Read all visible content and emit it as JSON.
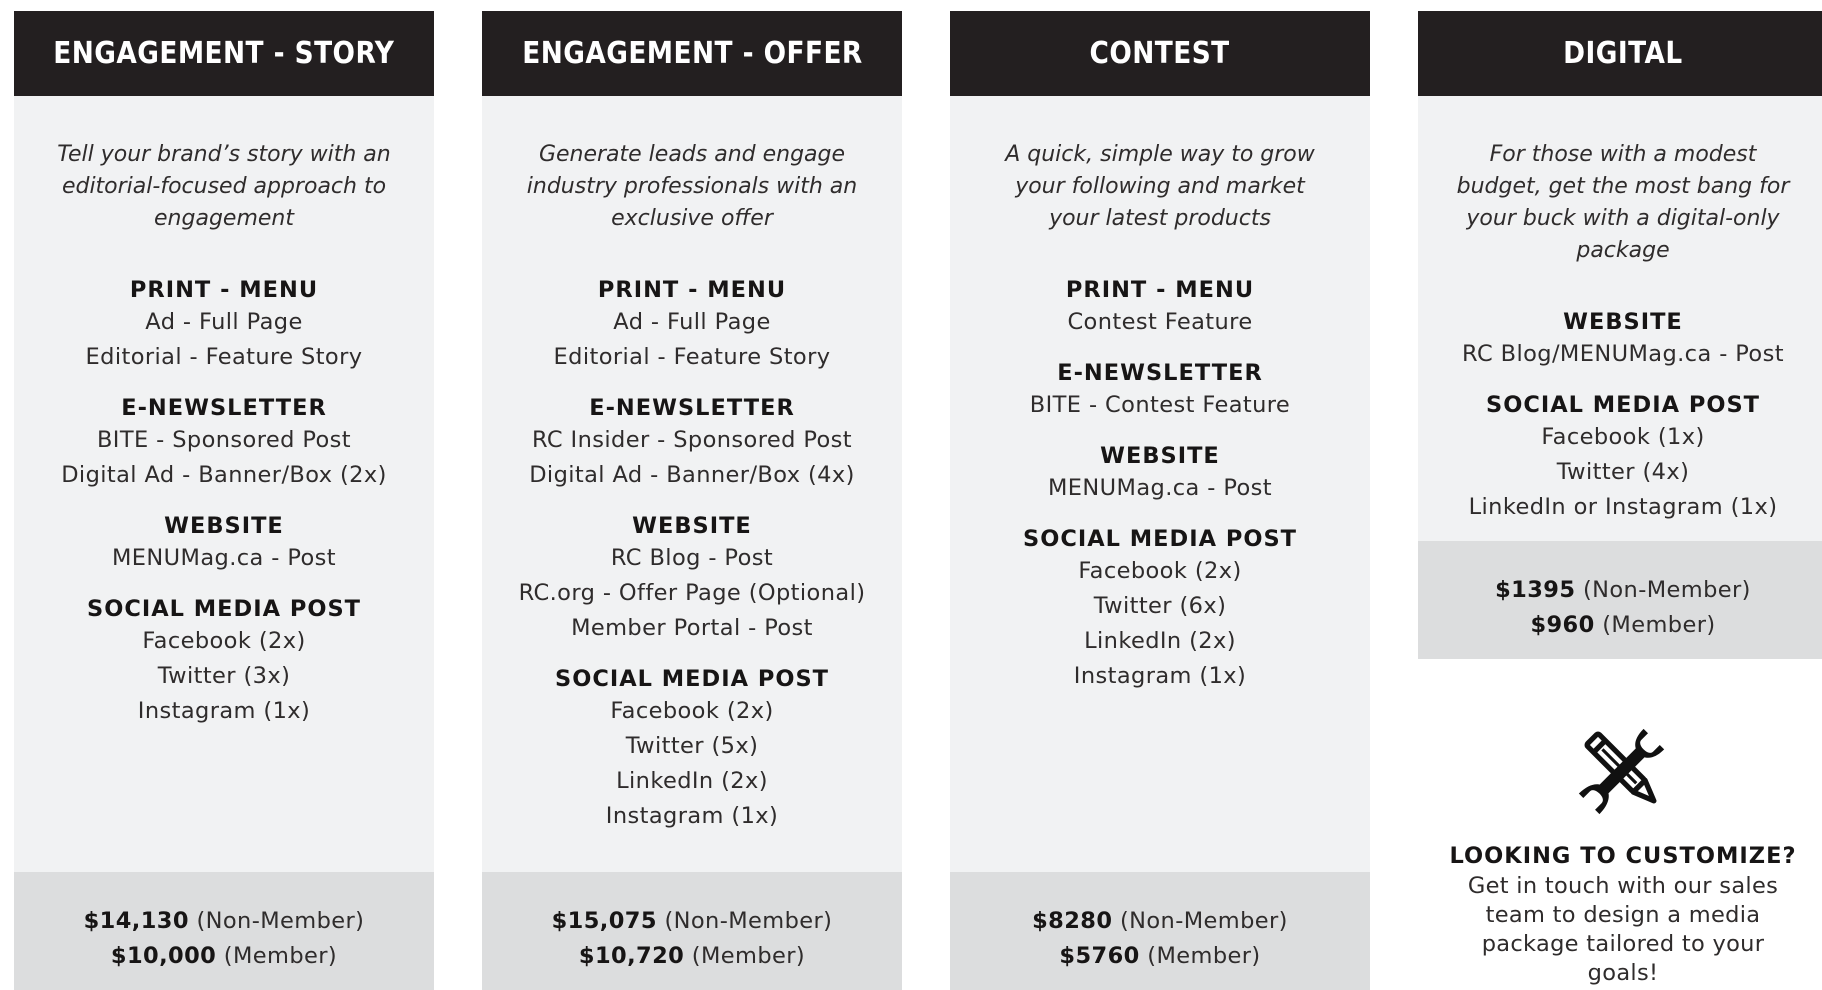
{
  "columns": [
    {
      "title": "ENGAGEMENT - STORY",
      "intro": "Tell your brand’s story with an editorial-focused approach to engagement",
      "sections": [
        {
          "title": "PRINT - MENU",
          "items": [
            "Ad - Full Page",
            "Editorial - Feature Story"
          ]
        },
        {
          "title": "E-NEWSLETTER",
          "items": [
            "BITE - Sponsored Post",
            "Digital Ad - Banner/Box (2x)"
          ]
        },
        {
          "title": "WEBSITE",
          "items": [
            "MENUMag.ca - Post"
          ]
        },
        {
          "title": "SOCIAL MEDIA POST",
          "items": [
            "Facebook (2x)",
            "Twitter (3x)",
            "Instagram (1x)"
          ]
        }
      ],
      "price_non_member": "$14,130",
      "non_member_label": "(Non-Member)",
      "price_member": "$10,000",
      "member_label": "(Member)"
    },
    {
      "title": "ENGAGEMENT - OFFER",
      "intro": "Generate leads and engage industry professionals with an exclusive offer",
      "sections": [
        {
          "title": "PRINT - MENU",
          "items": [
            "Ad - Full Page",
            "Editorial - Feature Story"
          ]
        },
        {
          "title": "E-NEWSLETTER",
          "items": [
            "RC Insider - Sponsored Post",
            "Digital Ad - Banner/Box (4x)"
          ]
        },
        {
          "title": "WEBSITE",
          "items": [
            "RC Blog - Post",
            "RC.org - Offer Page (Optional)",
            "Member Portal - Post"
          ]
        },
        {
          "title": "SOCIAL MEDIA POST",
          "items": [
            "Facebook (2x)",
            "Twitter (5x)",
            "LinkedIn (2x)",
            "Instagram (1x)"
          ]
        }
      ],
      "price_non_member": "$15,075",
      "non_member_label": "(Non-Member)",
      "price_member": "$10,720",
      "member_label": "(Member)"
    },
    {
      "title": "CONTEST",
      "intro": "A quick, simple way to grow your following and market your latest products",
      "sections": [
        {
          "title": "PRINT - MENU",
          "items": [
            "Contest Feature"
          ]
        },
        {
          "title": "E-NEWSLETTER",
          "items": [
            "BITE - Contest Feature"
          ]
        },
        {
          "title": "WEBSITE",
          "items": [
            "MENUMag.ca - Post"
          ]
        },
        {
          "title": "SOCIAL MEDIA POST",
          "items": [
            "Facebook (2x)",
            "Twitter (6x)",
            "LinkedIn (2x)",
            "Instagram (1x)"
          ]
        }
      ],
      "price_non_member": "$8280",
      "non_member_label": "(Non-Member)",
      "price_member": "$5760",
      "member_label": "(Member)"
    },
    {
      "title": "DIGITAL",
      "intro": "For those with a modest budget, get the most bang for your buck with a digital-only package",
      "sections": [
        {
          "title": "WEBSITE",
          "items": [
            "RC Blog/MENUMag.ca - Post"
          ]
        },
        {
          "title": "SOCIAL MEDIA POST",
          "items": [
            "Facebook (1x)",
            "Twitter (4x)",
            "LinkedIn or Instagram (1x)"
          ]
        }
      ],
      "price_non_member": "$1395",
      "non_member_label": "(Non-Member)",
      "price_member": "$960",
      "member_label": "(Member)"
    }
  ],
  "customize": {
    "icon": "tools-icon",
    "title": "LOOKING TO CUSTOMIZE?",
    "text": "Get in touch with our sales team to design a media package tailored to your goals!"
  }
}
